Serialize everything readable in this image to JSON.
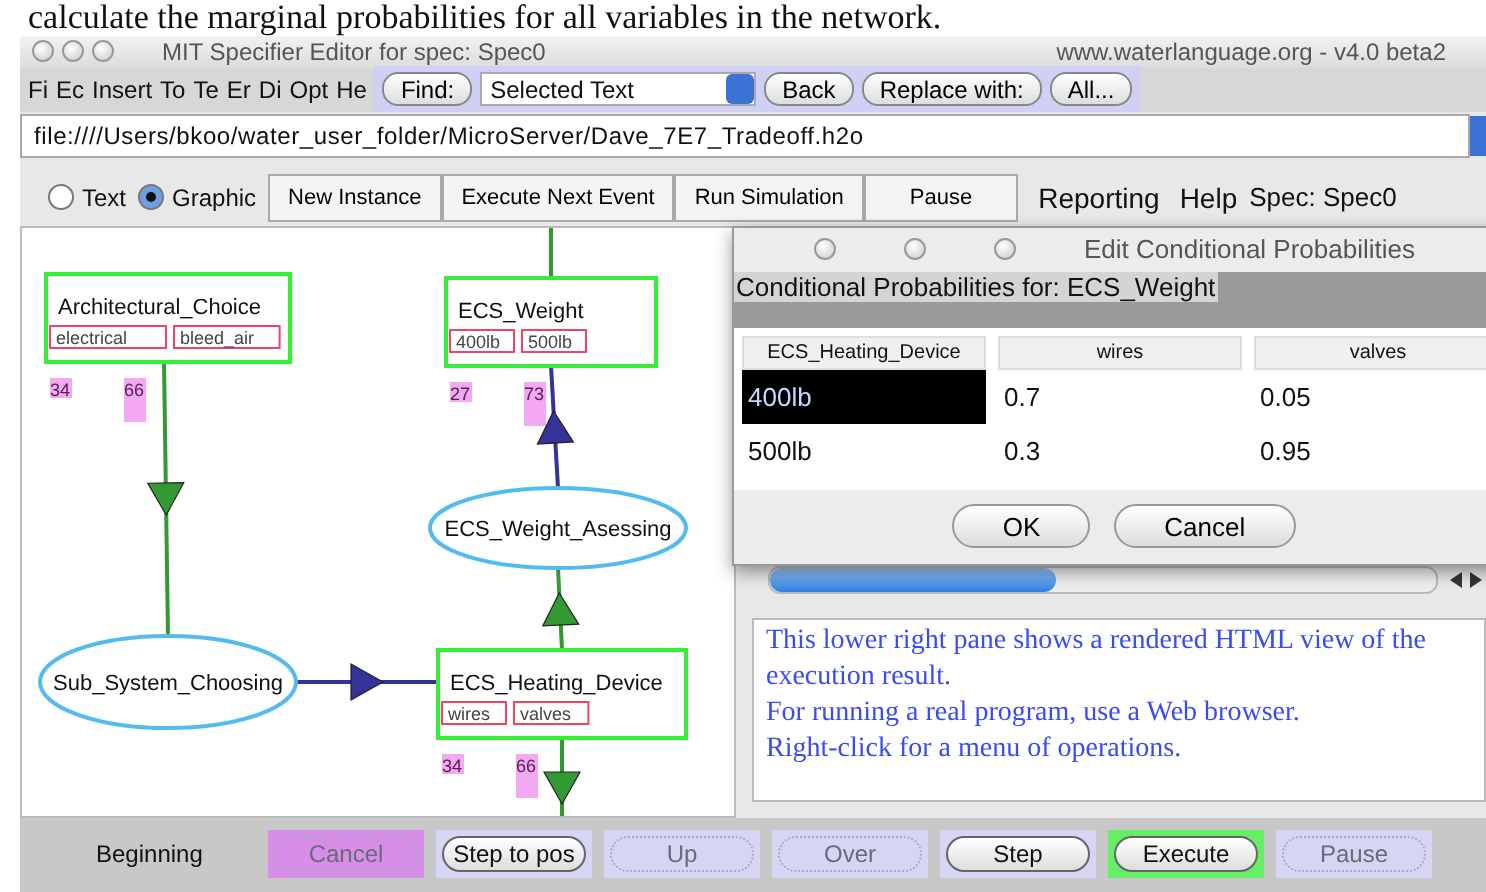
{
  "caption": "calculate the marginal probabilities for all variables in the network.",
  "window": {
    "title": "MIT Specifier Editor for spec: Spec0",
    "site": "www.waterlanguage.org - v4.0 beta2"
  },
  "menu": [
    "Fi",
    "Ec",
    "Insert",
    "To",
    "Te",
    "Er",
    "Di",
    "Opt",
    "He"
  ],
  "find": {
    "label": "Find:",
    "value": "Selected Text",
    "buttons": [
      "Back",
      "Replace with:",
      "All..."
    ]
  },
  "path": "file:////Users/bkoo/water_user_folder/MicroServer/Dave_7E7_Tradeoff.h2o",
  "modes": [
    {
      "label": "Text",
      "selected": false
    },
    {
      "label": "Graphic",
      "selected": true
    }
  ],
  "toolbar": [
    "New Instance",
    "Execute Next Event",
    "Run Simulation",
    "Pause"
  ],
  "menus_right": [
    "Reporting",
    "Help"
  ],
  "spec_label": "Spec: Spec0",
  "graph": {
    "nodes": [
      {
        "kind": "variable",
        "label": "Architectural_Choice",
        "states": [
          {
            "label": "electrical",
            "count": "34"
          },
          {
            "label": "bleed_air",
            "count": "66"
          }
        ]
      },
      {
        "kind": "variable",
        "label": "ECS_Weight",
        "states": [
          {
            "label": "400lb",
            "count": "27"
          },
          {
            "label": "500lb",
            "count": "73"
          }
        ]
      },
      {
        "kind": "process",
        "label": "ECS_Weight_Asessing"
      },
      {
        "kind": "process",
        "label": "Sub_System_Choosing"
      },
      {
        "kind": "variable",
        "label": "ECS_Heating_Device",
        "states": [
          {
            "label": "wires",
            "count": "34"
          },
          {
            "label": "valves",
            "count": "66"
          }
        ]
      }
    ]
  },
  "dialog": {
    "title": "Edit Conditional Probabilities",
    "header": "Conditional Probabilities for: ECS_Weight",
    "columns": [
      "ECS_Heating_Device",
      "wires",
      "valves"
    ],
    "rows": [
      {
        "cells": [
          "400lb",
          "0.7",
          "0.05"
        ],
        "selected": true
      },
      {
        "cells": [
          "500lb",
          "0.3",
          "0.95"
        ],
        "selected": false
      }
    ],
    "buttons": [
      "OK",
      "Cancel"
    ]
  },
  "html_pane": [
    "This lower right pane shows a rendered HTML view of the execution result.",
    "For running a real program, use a Web browser.",
    "Right-click for a menu of operations."
  ],
  "status": "Beginning",
  "controls": [
    {
      "label": "Cancel",
      "disabled": true,
      "color": "#d68ee8"
    },
    {
      "label": "Step to pos",
      "disabled": false,
      "color": "#d6d6f4"
    },
    {
      "label": "Up",
      "disabled": true,
      "color": "#d6d6f4"
    },
    {
      "label": "Over",
      "disabled": true,
      "color": "#d6d6f4"
    },
    {
      "label": "Step",
      "disabled": false,
      "color": "#d6d6f4"
    },
    {
      "label": "Execute",
      "disabled": false,
      "color": "#66ee66"
    },
    {
      "label": "Pause",
      "disabled": true,
      "color": "#d6d6f4"
    }
  ]
}
